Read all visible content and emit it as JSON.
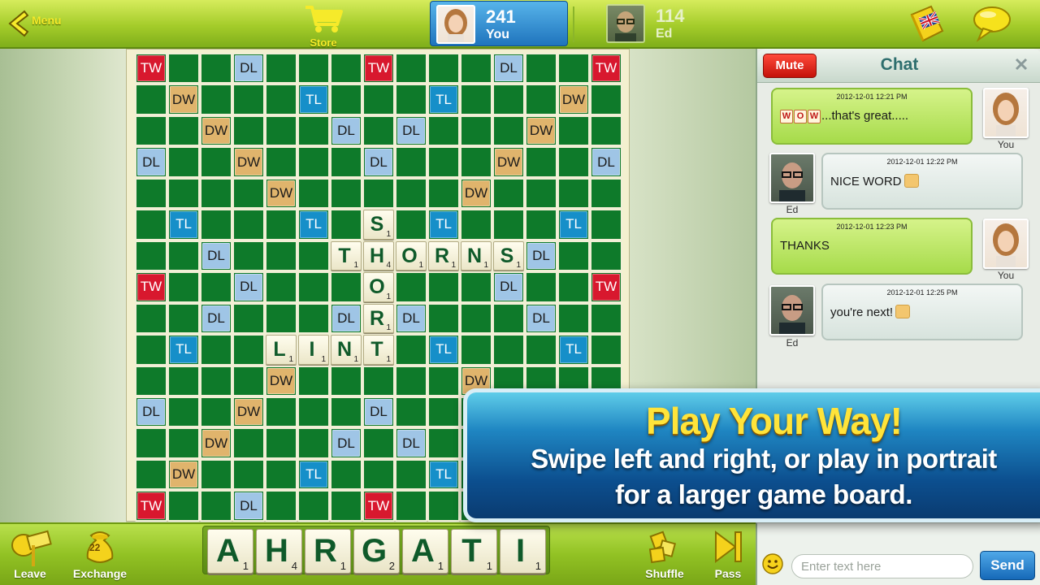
{
  "topbar": {
    "menu_label": "Menu",
    "store_label": "Store",
    "you": {
      "score": "241",
      "name": "You"
    },
    "opponent": {
      "score": "114",
      "name": "Ed"
    },
    "dictionary_flag": "united-kingdom-flag-icon"
  },
  "board": {
    "premium_rows": [
      "TW . . DL . . . TW . . . DL . . TW",
      ". DW . . . TL . . . TL . . . DW .",
      ". . DW . . . DL . DL . . . DW . .",
      "DL . . DW . . . DL . . . DW . . DL",
      ". . . . DW . . . . . DW . . . .",
      ". TL . . . TL . . . TL . . . TL .",
      ". . DL . . . DL . DL . . . DL . .",
      "TW . . DL . . . . . . . DL . . TW",
      ". . DL . . . DL . DL . . . DL . .",
      ". TL . . . TL . . . TL . . . TL .",
      ". . . . DW . . . . . DW . . . .",
      "DL . . DW . . . DL . . . DW . . DL",
      ". . DW . . . DL . DL . . . DW . .",
      ". DW . . . TL . . . TL . . . DW .",
      "TW . . DL . . . TW . . . DL . . TW"
    ],
    "placed_tiles": [
      {
        "row": 5,
        "col": 7,
        "letter": "S",
        "points": "1"
      },
      {
        "row": 6,
        "col": 6,
        "letter": "T",
        "points": "1"
      },
      {
        "row": 6,
        "col": 7,
        "letter": "H",
        "points": "4"
      },
      {
        "row": 6,
        "col": 8,
        "letter": "O",
        "points": "1"
      },
      {
        "row": 6,
        "col": 9,
        "letter": "R",
        "points": "1"
      },
      {
        "row": 6,
        "col": 10,
        "letter": "N",
        "points": "1"
      },
      {
        "row": 6,
        "col": 11,
        "letter": "S",
        "points": "1"
      },
      {
        "row": 7,
        "col": 7,
        "letter": "O",
        "points": "1"
      },
      {
        "row": 8,
        "col": 7,
        "letter": "R",
        "points": "1"
      },
      {
        "row": 9,
        "col": 4,
        "letter": "L",
        "points": "1"
      },
      {
        "row": 9,
        "col": 5,
        "letter": "I",
        "points": "1"
      },
      {
        "row": 9,
        "col": 6,
        "letter": "N",
        "points": "1"
      },
      {
        "row": 9,
        "col": 7,
        "letter": "T",
        "points": "1"
      }
    ]
  },
  "rack": [
    {
      "letter": "A",
      "points": "1"
    },
    {
      "letter": "H",
      "points": "4"
    },
    {
      "letter": "R",
      "points": "1"
    },
    {
      "letter": "G",
      "points": "2"
    },
    {
      "letter": "A",
      "points": "1"
    },
    {
      "letter": "T",
      "points": "1"
    },
    {
      "letter": "I",
      "points": "1"
    }
  ],
  "bottombar": {
    "leave_label": "Leave",
    "exchange_label": "Exchange",
    "exchange_count": "22",
    "shuffle_label": "Shuffle",
    "pass_label": "Pass"
  },
  "promo": {
    "title": "Play Your Way!",
    "line1": "Swipe left and right, or play in portrait",
    "line2": "for a larger game board."
  },
  "chat": {
    "mute_label": "Mute",
    "title": "Chat",
    "messages": [
      {
        "sender": "You",
        "timestamp": "2012-12-01 12:21 PM",
        "wow_tiles": [
          "W",
          "O",
          "W"
        ],
        "text": "...that's great....."
      },
      {
        "sender": "Ed",
        "timestamp": "2012-12-01 12:22 PM",
        "text": "NICE WORD"
      },
      {
        "sender": "You",
        "timestamp": "2012-12-01 12:23 PM",
        "text": "THANKS"
      },
      {
        "sender": "Ed",
        "timestamp": "2012-12-01 12:25 PM",
        "text": "you're next!"
      }
    ],
    "input_placeholder": "Enter text here",
    "send_label": "Send"
  },
  "colors": {
    "triple_word": "#d8182e",
    "double_word": "#e0b46c",
    "triple_letter": "#168fc9",
    "double_letter": "#9fc5e6",
    "board_green": "#0e7a2a",
    "accent_yellow": "#ffe43a"
  }
}
